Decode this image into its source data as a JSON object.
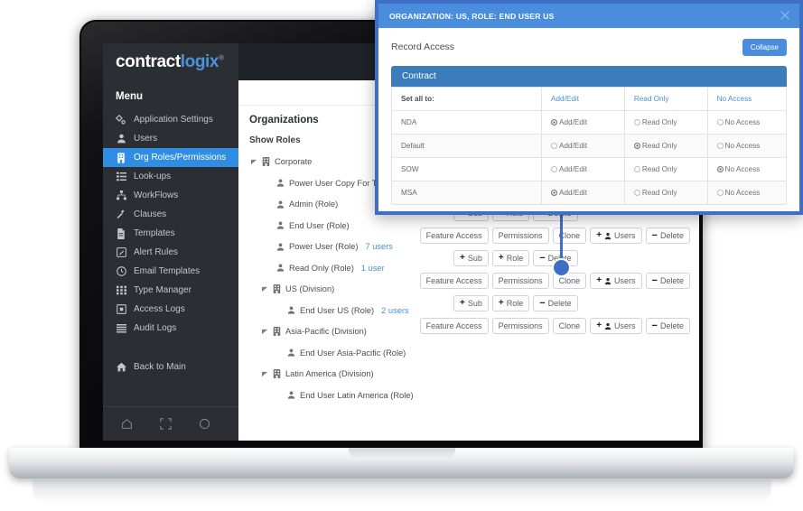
{
  "brand": {
    "name_part1": "contract",
    "name_part2": "logix",
    "trademark": "®",
    "accent_color": "#4a93dd"
  },
  "sidebar": {
    "menu_label": "Menu",
    "items": [
      {
        "label": "Application Settings",
        "icon": "settings-gears-icon",
        "active": false
      },
      {
        "label": "Users",
        "icon": "user-icon",
        "active": false
      },
      {
        "label": "Org Roles/Permissions",
        "icon": "org-roles-icon",
        "active": true
      },
      {
        "label": "Look-ups",
        "icon": "list-icon",
        "active": false
      },
      {
        "label": "WorkFlows",
        "icon": "workflow-icon",
        "active": false
      },
      {
        "label": "Clauses",
        "icon": "clauses-icon",
        "active": false
      },
      {
        "label": "Templates",
        "icon": "template-file-icon",
        "active": false
      },
      {
        "label": "Alert Rules",
        "icon": "edit-square-icon",
        "active": false
      },
      {
        "label": "Email Templates",
        "icon": "clock-icon",
        "active": false
      },
      {
        "label": "Type Manager",
        "icon": "grid-icon",
        "active": false
      },
      {
        "label": "Access Logs",
        "icon": "access-log-icon",
        "active": false
      },
      {
        "label": "Audit Logs",
        "icon": "audit-log-icon",
        "active": false
      }
    ],
    "back_to_main": {
      "label": "Back to Main",
      "icon": "home-icon"
    },
    "footer_icons": [
      "home-icon",
      "expand-icon",
      "power-icon"
    ]
  },
  "content": {
    "page_title": "Organizations",
    "show_roles_label": "Show Roles",
    "tree": [
      {
        "label": "Corporate",
        "suffix": "",
        "level": 0,
        "icon": "building-icon",
        "caret": true,
        "users": ""
      },
      {
        "label": "Power User Copy For TEST (R",
        "suffix": "",
        "level": 1,
        "icon": "person-icon",
        "caret": false,
        "users": ""
      },
      {
        "label": "Admin (Role)",
        "suffix": "",
        "level": 1,
        "icon": "person-icon",
        "caret": false,
        "users": ""
      },
      {
        "label": "End User (Role)",
        "suffix": "",
        "level": 1,
        "icon": "person-icon",
        "caret": false,
        "users": ""
      },
      {
        "label": "Power User (Role)",
        "suffix": "",
        "level": 1,
        "icon": "person-icon",
        "caret": false,
        "users": "7 users"
      },
      {
        "label": "Read Only (Role)",
        "suffix": "",
        "level": 1,
        "icon": "person-icon",
        "caret": false,
        "users": "1 user"
      },
      {
        "label": "US (Division)",
        "suffix": "",
        "level": 2,
        "icon": "building-icon",
        "caret": true,
        "users": ""
      },
      {
        "label": "End User US (Role)",
        "suffix": "",
        "level": 3,
        "icon": "person-icon",
        "caret": false,
        "users": "2 users"
      },
      {
        "label": "Asia-Pacific (Division)",
        "suffix": "",
        "level": 2,
        "icon": "building-icon",
        "caret": true,
        "users": ""
      },
      {
        "label": "End User Asia-Pacific (Role)",
        "suffix": "",
        "level": 3,
        "icon": "person-icon",
        "caret": false,
        "users": ""
      },
      {
        "label": "Latin America (Division)",
        "suffix": "",
        "level": 2,
        "icon": "building-icon",
        "caret": true,
        "users": ""
      },
      {
        "label": "End User Latin America (Role)",
        "suffix": "",
        "level": 3,
        "icon": "person-icon",
        "caret": false,
        "users": ""
      }
    ],
    "button_labels": {
      "feature_access": "Feature Access",
      "permissions": "Permissions",
      "clone": "Clone",
      "users": "Users",
      "delete": "Delete",
      "sub": "Sub",
      "role": "Role",
      "plus": "+",
      "minus": "−"
    },
    "action_rows": [
      {
        "type": "role",
        "indent": 0
      },
      {
        "type": "role",
        "indent": 0
      },
      {
        "type": "role",
        "indent": 0
      },
      {
        "type": "role",
        "indent": 0
      },
      {
        "type": "org",
        "indent": 0
      },
      {
        "type": "role",
        "indent": 1
      },
      {
        "type": "org",
        "indent": 0
      },
      {
        "type": "role",
        "indent": 1
      },
      {
        "type": "org",
        "indent": 0
      },
      {
        "type": "role",
        "indent": 1
      }
    ]
  },
  "modal": {
    "title": "ORGANIZATION: US, ROLE: END USER US",
    "close_icon": "close-icon",
    "section_title": "Record Access",
    "collapse_label": "Collapse",
    "group_title": "Contract",
    "header_color": "#4a8ddc",
    "border_color": "#3f6fc4",
    "table": {
      "columns": [
        "Set all to:",
        "Add/Edit",
        "Read Only",
        "No Access"
      ],
      "option_labels": [
        "Add/Edit",
        "Read Only",
        "No Access"
      ],
      "rows": [
        {
          "name": "NDA",
          "selected": 0
        },
        {
          "name": "Default",
          "selected": 1
        },
        {
          "name": "SOW",
          "selected": 2
        },
        {
          "name": "MSA",
          "selected": 0
        }
      ]
    }
  }
}
